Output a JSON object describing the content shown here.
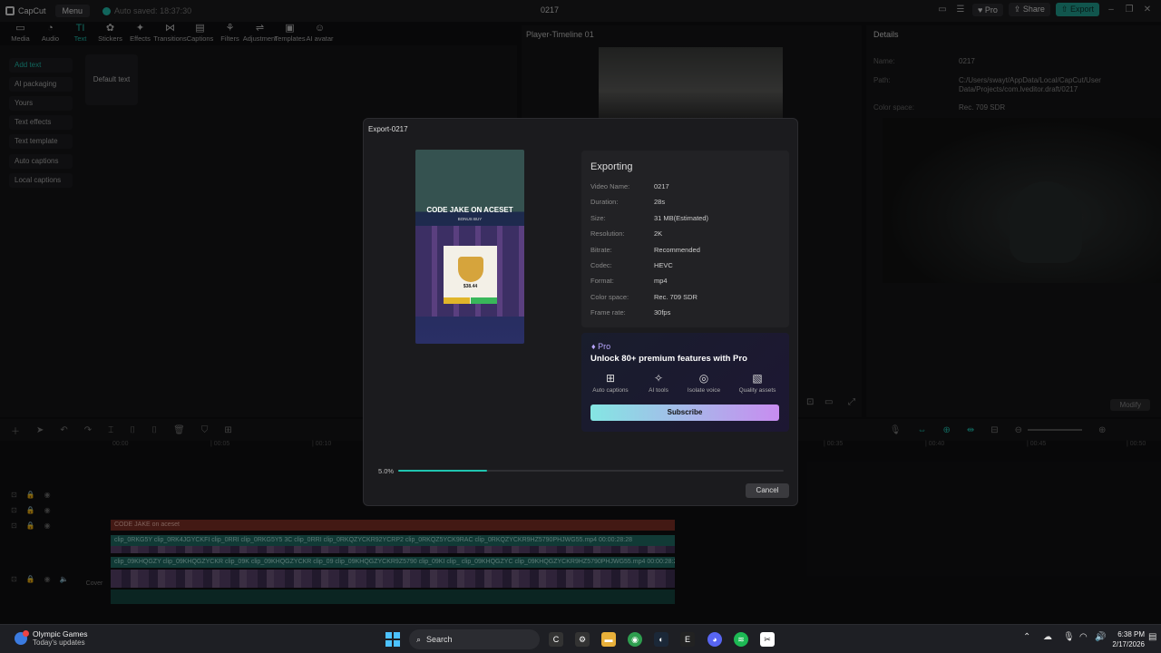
{
  "titlebar": {
    "app": "CapCut",
    "menu": "Menu",
    "autosave": "Auto saved: 18:37:30",
    "title": "0217",
    "pro": "Pro",
    "share": "Share",
    "export": "Export"
  },
  "toolbar": [
    {
      "label": "Media",
      "icon": "▭"
    },
    {
      "label": "Audio",
      "icon": "◔"
    },
    {
      "label": "Text",
      "icon": "TI"
    },
    {
      "label": "Stickers",
      "icon": "✿"
    },
    {
      "label": "Effects",
      "icon": "✦"
    },
    {
      "label": "Transitions",
      "icon": "⋈"
    },
    {
      "label": "Captions",
      "icon": "▤"
    },
    {
      "label": "Filters",
      "icon": "⚘"
    },
    {
      "label": "Adjustment",
      "icon": "⇌"
    },
    {
      "label": "Templates",
      "icon": "▣"
    },
    {
      "label": "AI avatar",
      "icon": "☺"
    }
  ],
  "left_menu": [
    "Add text",
    "AI packaging",
    "Yours",
    "Text effects",
    "Text template",
    "Auto captions",
    "Local captions"
  ],
  "text_panel": {
    "default": "Default text"
  },
  "player": {
    "title": "Player-Timeline 01"
  },
  "details": {
    "title": "Details",
    "modify": "Modify",
    "rows": [
      {
        "k": "Name:",
        "v": "0217"
      },
      {
        "k": "Path:",
        "v": "C:/Users/swayt/AppData/Local/CapCut/User Data/Projects/com.lveditor.draft/0217"
      },
      {
        "k": "Color space:",
        "v": "Rec. 709 SDR"
      }
    ]
  },
  "timeline": {
    "ticks": [
      "00:00",
      "| 00:05",
      "| 00:10",
      "| 00:35",
      "| 00:40",
      "| 00:45",
      "| 00:50"
    ],
    "text_clip": "CODE JAKE on aceset",
    "clip_row1": "clip_0RKG5Y  clip_0RK4JGYCKFI  clip_0RRI  clip_0RKG5Y5 3C  clip_0RRI  clip_0RKQZYCKR92YCRP2  clip_0RKQZ5YCK9RAC  clip_0RKQZYCKR9HZ5790PHJWG55.mp4  00:00:28:28",
    "clip_row2": "clip_09KHQGZY  clip_09KHQGZYCKR  clip_09K  clip_09KHQGZYCKR  clip_09  clip_09KHQGZYCKR9Z5790  clip_09KI  clip_  clip_09KHQGZYC  clip_09KHQGZYCKR9HZ5790PHJWG55.mp4  00:00:28:28",
    "cover": "Cover"
  },
  "export": {
    "title": "Export-0217",
    "heading": "Exporting",
    "fields": [
      {
        "k": "Video Name:",
        "v": "0217"
      },
      {
        "k": "Duration:",
        "v": "28s"
      },
      {
        "k": "Size:",
        "v": "31 MB(Estimated)"
      },
      {
        "k": "Resolution:",
        "v": "2K"
      },
      {
        "k": "Bitrate:",
        "v": "Recommended"
      },
      {
        "k": "Codec:",
        "v": "HEVC"
      },
      {
        "k": "Format:",
        "v": "mp4"
      },
      {
        "k": "Color space:",
        "v": "Rec. 709 SDR"
      },
      {
        "k": "Frame rate:",
        "v": "30fps"
      }
    ],
    "preview_caption": "CODE JAKE ON ACESET",
    "preview_sub": "BONUS BUY",
    "preview_price": "$38.44",
    "progress_label": "5.0%",
    "progress": 0.05,
    "cancel": "Cancel",
    "pro": {
      "tag": "Pro",
      "headline": "Unlock 80+ premium features with Pro",
      "features": [
        {
          "label": "Auto captions",
          "icon": "⊞"
        },
        {
          "label": "AI tools",
          "icon": "✧"
        },
        {
          "label": "Isolate voice",
          "icon": "◎"
        },
        {
          "label": "Quality assets",
          "icon": "▧"
        }
      ],
      "subscribe": "Subscribe"
    }
  },
  "taskbar": {
    "news_title": "Olympic Games",
    "news_sub": "Today's updates",
    "search": "Search",
    "time": "6:38 PM",
    "date": "2/17/2026"
  },
  "colors": {
    "accent": "#1fb9a8",
    "bg": "#101012",
    "subscribe_from": "#84e6e3",
    "subscribe_to": "#c88cf0"
  }
}
